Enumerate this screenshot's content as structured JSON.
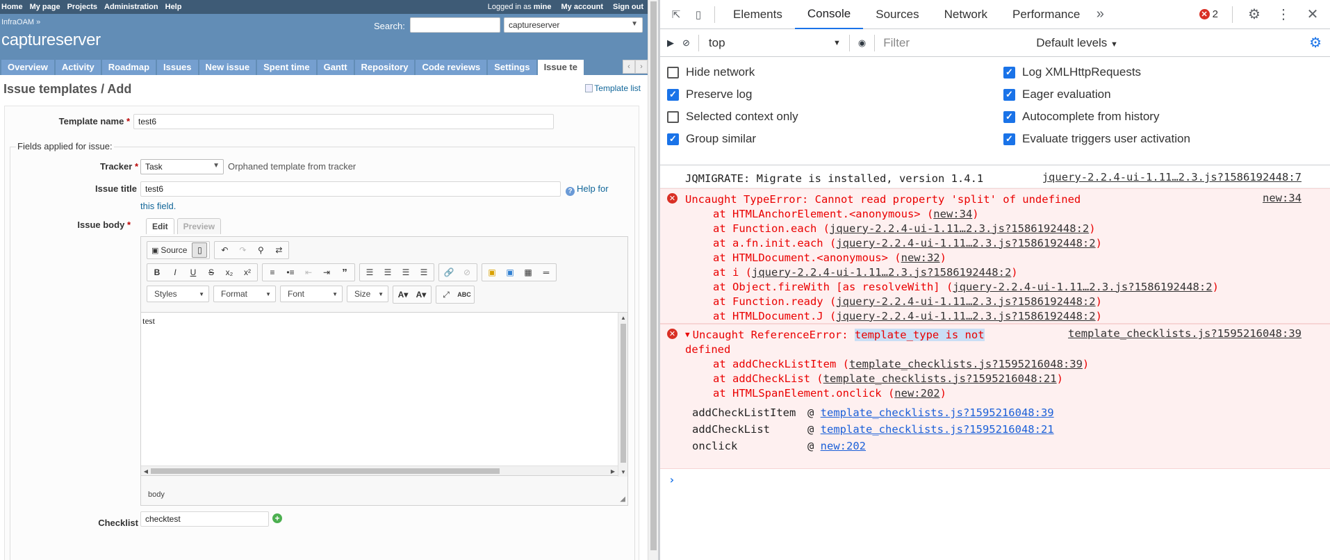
{
  "top_menu": {
    "left": [
      "Home",
      "My page",
      "Projects",
      "Administration",
      "Help"
    ],
    "logged_prefix": "Logged in as",
    "logged_user": "mine",
    "right": [
      "My account",
      "Sign out"
    ]
  },
  "header": {
    "breadcrumb": "InfraOAM »",
    "project": "captureserver",
    "search_label": "Search:",
    "search_value": "",
    "project_select": "captureserver"
  },
  "main_menu": {
    "tabs": [
      "Overview",
      "Activity",
      "Roadmap",
      "Issues",
      "New issue",
      "Spent time",
      "Gantt",
      "Repository",
      "Code reviews",
      "Settings",
      "Issue te"
    ],
    "selected_index": 10,
    "scroll_left": "‹",
    "scroll_right": "›"
  },
  "page": {
    "title": "Issue templates / Add",
    "template_list_link": "Template list"
  },
  "form": {
    "template_name_label": "Template name",
    "template_name_value": "test6",
    "fieldset_legend": "Fields applied for issue:",
    "tracker_label": "Tracker",
    "tracker_value": "Task",
    "tracker_note": "Orphaned template from tracker",
    "issue_title_label": "Issue title",
    "issue_title_value": "test6",
    "help_link_1": "Help for",
    "help_link_2": "this field.",
    "issue_body_label": "Issue body",
    "tab_edit": "Edit",
    "tab_preview": "Preview",
    "body_text": "test",
    "statusbar": "body",
    "checklist_label": "Checklist",
    "checklist_value": "checktest"
  },
  "editor": {
    "source_label": "Source",
    "styles": "Styles",
    "format": "Format",
    "font": "Font",
    "size": "Size"
  },
  "devtools": {
    "tabs": [
      "Elements",
      "Console",
      "Sources",
      "Network",
      "Performance"
    ],
    "active_tab": "Console",
    "error_count": "2",
    "context": "top",
    "filter_placeholder": "Filter",
    "levels": "Default levels",
    "options_left": [
      {
        "label": "Hide network",
        "checked": false
      },
      {
        "label": "Preserve log",
        "checked": true
      },
      {
        "label": "Selected context only",
        "checked": false
      },
      {
        "label": "Group similar",
        "checked": true
      }
    ],
    "options_right": [
      {
        "label": "Log XMLHttpRequests",
        "checked": true
      },
      {
        "label": "Eager evaluation",
        "checked": true
      },
      {
        "label": "Autocomplete from history",
        "checked": true
      },
      {
        "label": "Evaluate triggers user activation",
        "checked": true
      }
    ],
    "log1": {
      "text": "JQMIGRATE: Migrate is installed, version 1.4.1",
      "source": "jquery-2.2.4-ui-1.11…2.3.js?1586192448:7"
    },
    "err1": {
      "message": "Uncaught TypeError: Cannot read property 'split' of undefined",
      "source": "new:34",
      "stack": [
        {
          "fn": "at HTMLAnchorElement.<anonymous> (",
          "link": "new:34",
          "end": ")"
        },
        {
          "fn": "at Function.each (",
          "link": "jquery-2.2.4-ui-1.11…2.3.js?1586192448:2",
          "end": ")"
        },
        {
          "fn": "at a.fn.init.each (",
          "link": "jquery-2.2.4-ui-1.11…2.3.js?1586192448:2",
          "end": ")"
        },
        {
          "fn": "at HTMLDocument.<anonymous> (",
          "link": "new:32",
          "end": ")"
        },
        {
          "fn": "at i (",
          "link": "jquery-2.2.4-ui-1.11…2.3.js?1586192448:2",
          "end": ")"
        },
        {
          "fn": "at Object.fireWith [as resolveWith] (",
          "link": "jquery-2.2.4-ui-1.11…2.3.js?1586192448:2",
          "end": ")"
        },
        {
          "fn": "at Function.ready (",
          "link": "jquery-2.2.4-ui-1.11…2.3.js?1586192448:2",
          "end": ")"
        },
        {
          "fn": "at HTMLDocument.J (",
          "link": "jquery-2.2.4-ui-1.11…2.3.js?1586192448:2",
          "end": ")"
        }
      ]
    },
    "err2": {
      "prefix": "Uncaught ReferenceError: ",
      "highlight": "template_type is not",
      "line2": "defined",
      "source": "template_checklists.js?1595216048:39",
      "stack": [
        {
          "fn": "at addCheckListItem (",
          "link": "template_checklists.js?1595216048:39",
          "end": ")"
        },
        {
          "fn": "at addCheckList (",
          "link": "template_checklists.js?1595216048:21",
          "end": ")"
        },
        {
          "fn": "at HTMLSpanElement.onclick (",
          "link": "new:202",
          "end": ")"
        }
      ],
      "frames": [
        {
          "fn": "addCheckListItem",
          "link": "template_checklists.js?1595216048:39"
        },
        {
          "fn": "addCheckList",
          "link": "template_checklists.js?1595216048:21"
        },
        {
          "fn": "onclick",
          "link": "new:202"
        }
      ]
    }
  }
}
